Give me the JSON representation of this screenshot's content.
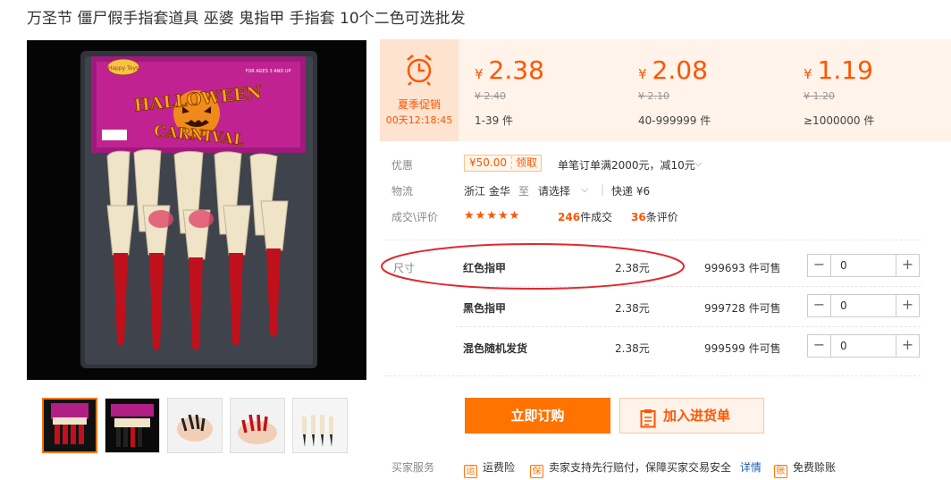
{
  "product": {
    "title": "万圣节 僵尸假手指套道具 巫婆 鬼指甲 手指套 10个二色可选批发"
  },
  "packaging": {
    "badge_text": "Happy Toys",
    "age_text": "FOR AGES 3 AND UP",
    "headline_1": "HALLOWEEN",
    "headline_2": "CARNIVAL"
  },
  "promo": {
    "label": "夏季促销",
    "countdown": "00天12:18:45",
    "icon": "alarm-clock-icon"
  },
  "price_tiers": [
    {
      "currency": "¥",
      "price": "2.38",
      "original": "¥ 2.40",
      "qty": "1-39 件"
    },
    {
      "currency": "¥",
      "price": "2.08",
      "original": "¥ 2.10",
      "qty": "40-999999 件"
    },
    {
      "currency": "¥",
      "price": "1.19",
      "original": "¥ 1.20",
      "qty": "≥1000000 件"
    }
  ],
  "discount": {
    "key": "优惠",
    "coupon_amount": "¥50.00",
    "coupon_action": "领取",
    "desc": "单笔订单满2000元，减10元"
  },
  "logistics": {
    "key": "物流",
    "origin": "浙江 金华",
    "to": "至",
    "dest": "请选择",
    "shipping": "快递 ¥6"
  },
  "reviews": {
    "key": "成交\\评价",
    "stars": "★★★★★",
    "deals_count": "246",
    "deals_label": "件成交",
    "reviews_count": "36",
    "reviews_label": "条评价"
  },
  "sku": {
    "label": "尺寸",
    "rows": [
      {
        "name": "红色指甲",
        "price": "2.38元",
        "stock": "999693 件可售",
        "qty": "0"
      },
      {
        "name": "黑色指甲",
        "price": "2.38元",
        "stock": "999728 件可售",
        "qty": "0"
      },
      {
        "name": "混色随机发货",
        "price": "2.38元",
        "stock": "999599 件可售",
        "qty": "0"
      }
    ]
  },
  "actions": {
    "buy": "立即订购",
    "cart": "加入进货单"
  },
  "services": {
    "key": "买家服务",
    "items": [
      {
        "icon": "freight-insurance-icon",
        "glyph": "运",
        "label": "运费险"
      },
      {
        "icon": "shield-icon",
        "glyph": "保",
        "label": "卖家支持先行赔付，保障买家交易安全"
      },
      {
        "icon": "receipt-icon",
        "glyph": "账",
        "label": "免费赊账"
      }
    ],
    "details_link": "详情"
  },
  "colors": {
    "accent": "#ff5500",
    "button": "#ff7300",
    "annotation": "#e0282e"
  }
}
